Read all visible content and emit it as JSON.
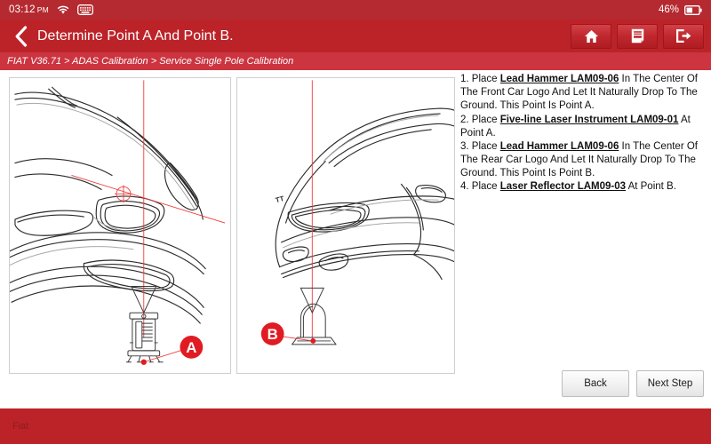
{
  "statusbar": {
    "time": "03:12",
    "ampm": "PM",
    "wifi_icon": "wifi-icon",
    "keyboard_icon": "keyboard-icon",
    "battery_percent": "46%",
    "battery_icon": "battery-icon"
  },
  "header": {
    "back_icon": "chevron-left-icon",
    "title": "Determine Point A And Point B.",
    "tools": [
      {
        "name": "home-button",
        "icon": "home-icon"
      },
      {
        "name": "report-button",
        "icon": "report-icon"
      },
      {
        "name": "exit-button",
        "icon": "exit-icon"
      }
    ]
  },
  "breadcrumb": {
    "text": "FIAT V36.71 > ADAS Calibration > Service Single Pole Calibration"
  },
  "diagrams": {
    "left": {
      "name": "front-car-calibration-diagram",
      "marker_label": "A",
      "caption": "Front car logo with lead hammer and five-line laser instrument at Point A"
    },
    "right": {
      "name": "rear-car-calibration-diagram",
      "marker_label": "B",
      "caption": "Rear car logo with lead hammer and laser reflector at Point B"
    }
  },
  "instructions": [
    {
      "number": "1. ",
      "pre": "Place ",
      "tool": "Lead Hammer LAM09-06",
      "post": " In The Center Of The Front Car Logo And Let It Naturally Drop To The Ground. This Point Is Point A."
    },
    {
      "number": "2. ",
      "pre": "Place ",
      "tool": "Five-line Laser Instrument LAM09-01",
      "post": " At Point A."
    },
    {
      "number": "3. ",
      "pre": "Place ",
      "tool": "Lead Hammer LAM09-06",
      "post": " In The Center Of The Rear Car Logo And Let It Naturally Drop To The Ground. This Point Is Point B."
    },
    {
      "number": "4. ",
      "pre": "Place ",
      "tool": "Laser Reflector LAM09-03",
      "post": " At Point B."
    }
  ],
  "footer": {
    "back_label": "Back",
    "next_label": "Next Step"
  },
  "bottombar": {
    "label": "Fiat"
  },
  "colors": {
    "brand_red": "#bc2328",
    "statusbar_red": "#b52a30",
    "breadcrumb_red": "#cc3440",
    "marker_red": "#e11b22",
    "laser_red": "#ef3c3c"
  }
}
